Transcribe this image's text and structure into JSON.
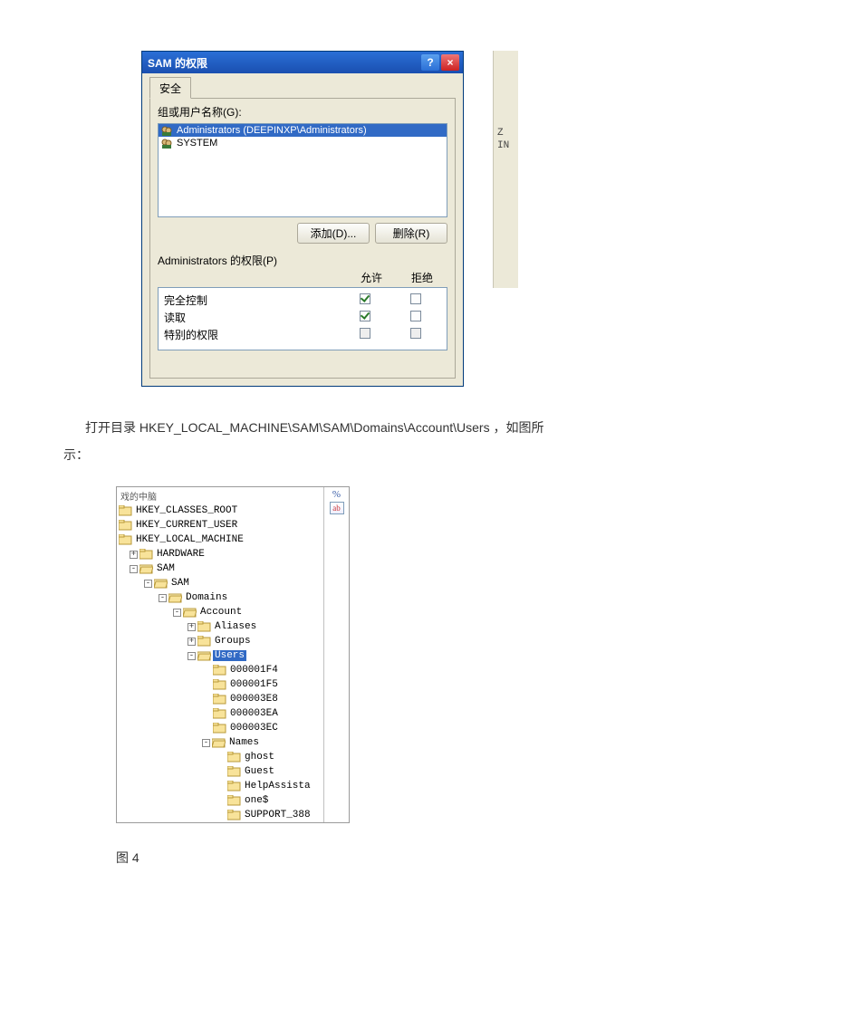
{
  "dialog": {
    "title": "SAM 的权限",
    "tab_label": "安全",
    "group_label": "组或用户名称(G):",
    "list": [
      {
        "text": "Administrators (DEEPINXP\\Administrators)",
        "selected": true
      },
      {
        "text": "SYSTEM",
        "selected": false
      }
    ],
    "add_btn": "添加(D)...",
    "remove_btn": "删除(R)",
    "perm_label": "Administrators 的权限(P)",
    "col_allow": "允许",
    "col_deny": "拒绝",
    "rows": [
      {
        "name": "完全控制",
        "allow": true,
        "deny": false,
        "allow_disabled": false,
        "deny_disabled": false
      },
      {
        "name": "读取",
        "allow": true,
        "deny": false,
        "allow_disabled": false,
        "deny_disabled": false
      },
      {
        "name": "特别的权限",
        "allow": false,
        "deny": false,
        "allow_disabled": true,
        "deny_disabled": true
      }
    ],
    "help_glyph": "?",
    "close_glyph": "×",
    "backdrop_sample": "Z\nIN"
  },
  "paragraph": {
    "line1_prefix": "打开目录 ",
    "line1_path": "HKEY_LOCAL_MACHINE\\SAM\\SAM\\Domains\\Account\\Users ",
    "line1_suffix": "，如图所",
    "line2": "示："
  },
  "reg": {
    "top_text": "戏的中脑",
    "root1": "HKEY_CLASSES_ROOT",
    "root2": "HKEY_CURRENT_USER",
    "root3": "HKEY_LOCAL_MACHINE",
    "hardware": "HARDWARE",
    "sam1": "SAM",
    "sam2": "SAM",
    "domains": "Domains",
    "account": "Account",
    "aliases": "Aliases",
    "groups": "Groups",
    "users": "Users",
    "u1": "000001F4",
    "u2": "000001F5",
    "u3": "000003E8",
    "u4": "000003EA",
    "u5": "000003EC",
    "names": "Names",
    "n1": "ghost",
    "n2": "Guest",
    "n3": "HelpAssista",
    "n4": "one$",
    "n5": "SUPPORT_388",
    "right_top": "%",
    "right_ab": "ab"
  },
  "figcap": "图 4"
}
